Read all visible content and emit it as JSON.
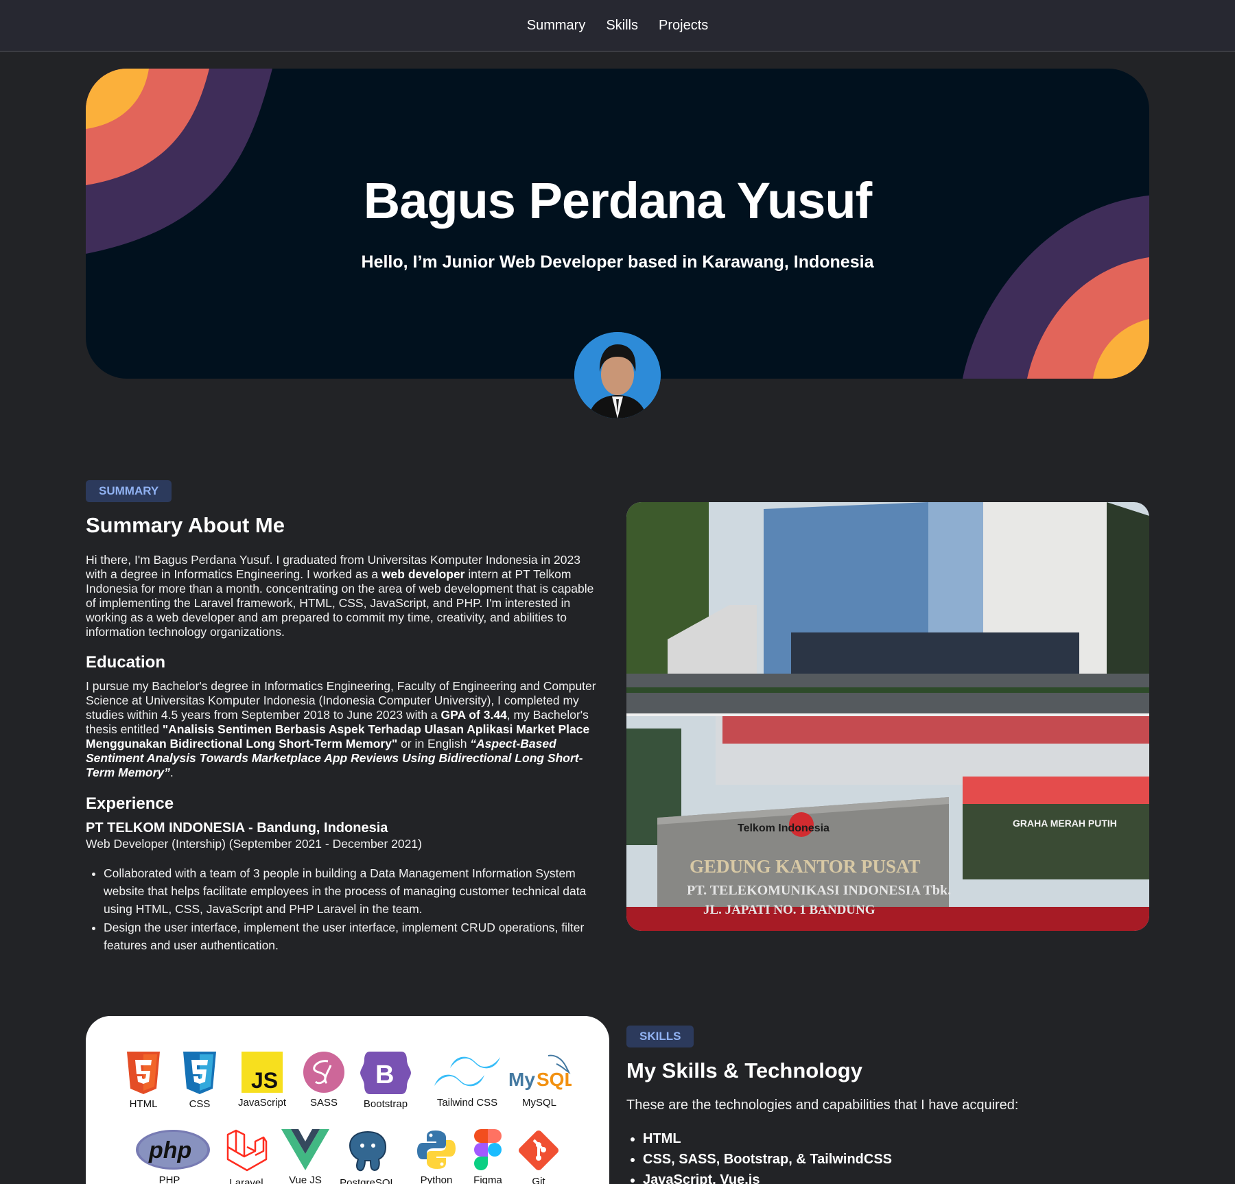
{
  "nav": {
    "items": [
      "Summary",
      "Skills",
      "Projects"
    ]
  },
  "hero": {
    "title": "Bagus Perdana Yusuf",
    "subtitle": "Hello, I’m Junior Web Developer based in Karawang, Indonesia"
  },
  "colors": {
    "accent_orange": "#fbb03b",
    "accent_coral": "#e2655a",
    "accent_purple": "#3f2d59",
    "hero_bg": "#01111e",
    "badge_bg": "#2c3a5c",
    "badge_text": "#91b2f2"
  },
  "summary": {
    "badge": "SUMMARY",
    "title": "Summary About Me",
    "paragraph": {
      "p1": "Hi there, I'm Bagus Perdana Yusuf. I graduated from Universitas Komputer Indonesia in 2023 with a degree in Informatics Engineering. I worked as a ",
      "bold": "web developer",
      "p2": " intern at PT Telkom Indonesia for more than a month. concentrating on the area of web development that is capable of implementing the Laravel framework, HTML, CSS, JavaScript, and PHP. I'm interested in working as a web developer and am prepared to commit my time, creativity, and abilities to information technology organizations."
    },
    "education": {
      "title": "Education",
      "t1": "I pursue my Bachelor's degree in Informatics Engineering, Faculty of Engineering and Computer Science at Universitas Komputer Indonesia (Indonesia Computer University), I completed my studies within 4.5 years from September 2018 to June 2023 with a ",
      "gpa": "GPA of 3.44",
      "t2": ", my Bachelor's thesis entitled ",
      "thesis": "\"Analisis Sentimen Berbasis Aspek Terhadap Ulasan Aplikasi Market Place Menggunakan Bidirectional Long Short-Term Memory\"",
      "t3": " or in English ",
      "thesis_en": "“Aspect-Based Sentiment Analysis Towards Marketplace App Reviews Using Bidirectional Long Short-Term Memory”",
      "t4": "."
    },
    "experience": {
      "title": "Experience",
      "company": "PT TELKOM INDONESIA - Bandung, Indonesia",
      "role": "Web Developer (Intership) (September 2021 - December 2021)",
      "bullets": [
        "Collaborated with a team of 3 people in building a Data Management Information System website that helps facilitate employees in the process of managing customer technical data using HTML, CSS, JavaScript and PHP Laravel in the team.",
        "Design the user interface, implement the user interface, implement CRUD operations, filter features and user authentication."
      ]
    },
    "photo_sign": {
      "brand": "Telkom Indonesia",
      "line1": "GEDUNG KANTOR PUSAT",
      "line2": "PT. TELEKOMUNIKASI INDONESIA Tbk.",
      "line3": "JL. JAPATI NO. 1 BANDUNG",
      "side": "GRAHA MERAH PUTIH"
    }
  },
  "skills": {
    "badge": "SKILLS",
    "title": "My Skills & Technology",
    "intro": "These are the technologies and capabilities that I have acquired:",
    "icons": [
      "HTML",
      "CSS",
      "JavaScript",
      "SASS",
      "Bootstrap",
      "Tailwind CSS",
      "MySQL",
      "PHP",
      "Laravel",
      "Vue JS",
      "PostgreSQL",
      "Python",
      "Figma",
      "Git"
    ],
    "list": [
      "HTML",
      "CSS, SASS, Bootstrap, & TailwindCSS",
      "JavaScript, Vue.js"
    ]
  }
}
